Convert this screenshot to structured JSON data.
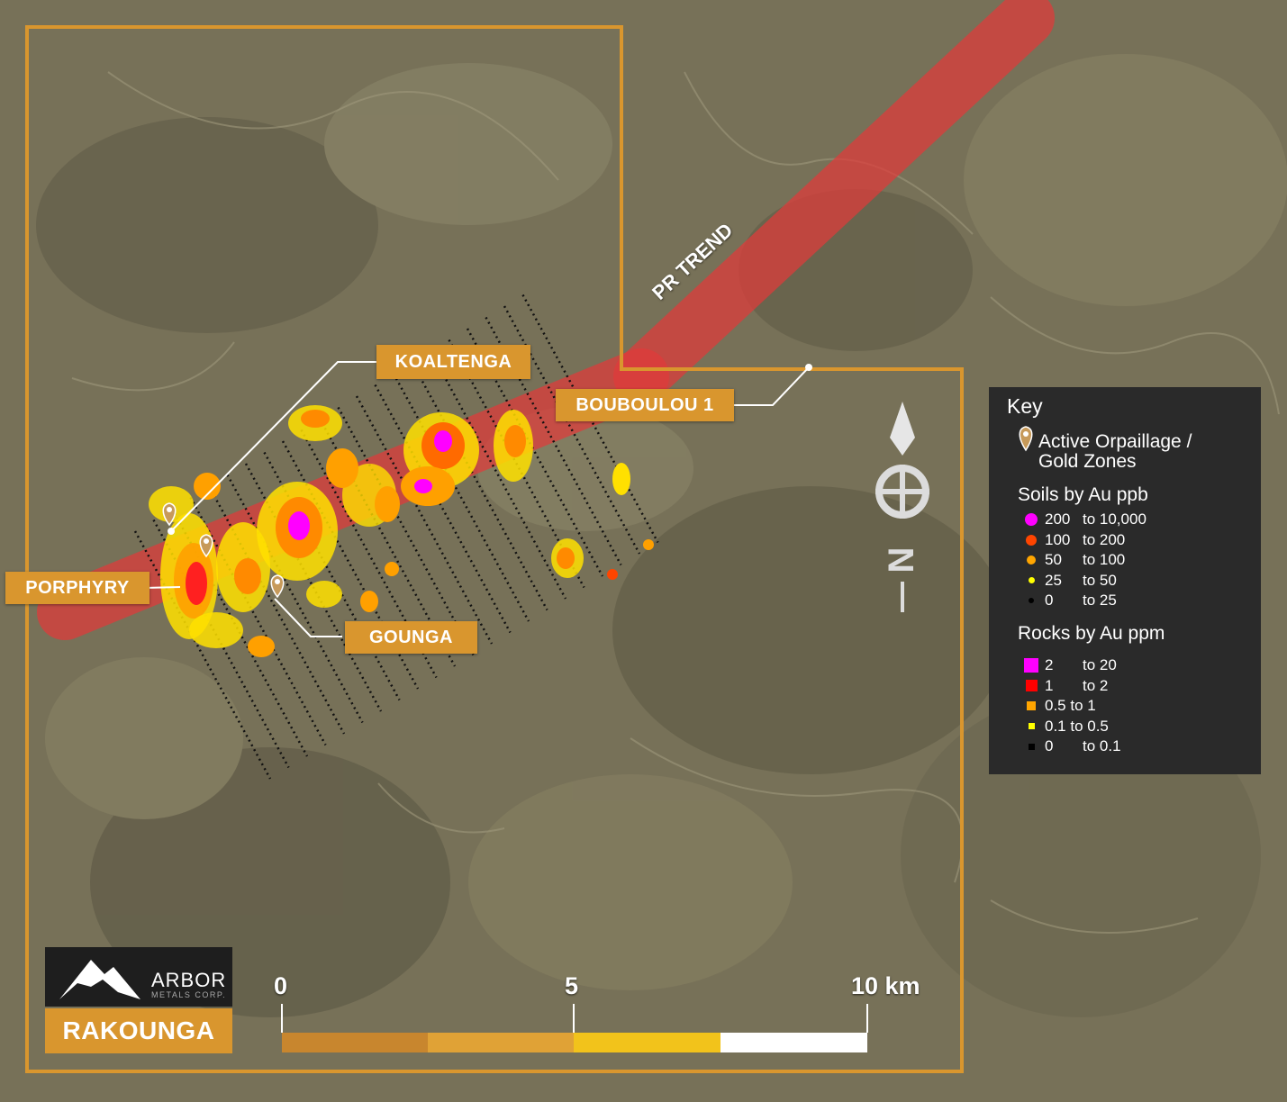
{
  "map": {
    "project_name": "RAKOUNGA",
    "trend_label": "PR TREND",
    "company": {
      "name": "ARBOR",
      "subname": "METALS CORP."
    },
    "callouts": {
      "koaltenga": "KOALTENGA",
      "bouboulou": "BOUBOULOU 1",
      "porphyry": "PORPHYRY",
      "gounga": "GOUNGA"
    },
    "north_label": "N",
    "scale": {
      "ticks": [
        "0",
        "5",
        "10 km"
      ],
      "colors": [
        "#c8862e",
        "#e0a236",
        "#f2c31b",
        "#ffffff"
      ]
    }
  },
  "key": {
    "title": "Key",
    "orpaillage_line1": "Active Orpaillage /",
    "orpaillage_line2": "Gold Zones",
    "soils_title": "Soils by Au ppb",
    "soils": [
      {
        "lo": "200",
        "hi": "to 10,000",
        "color": "#ff00ff"
      },
      {
        "lo": "100",
        "hi": "to 200",
        "color": "#ff4500"
      },
      {
        "lo": "50",
        "hi": "to 100",
        "color": "#ffa500"
      },
      {
        "lo": "25",
        "hi": "to 50",
        "color": "#ffff00"
      },
      {
        "lo": "0",
        "hi": "to 25",
        "color": "#000000"
      }
    ],
    "rocks_title": "Rocks by Au ppm",
    "rocks": [
      {
        "lo": "2",
        "hi": "to 20",
        "color": "#ff00ff"
      },
      {
        "lo": "1",
        "hi": "to 2",
        "color": "#ff0000"
      },
      {
        "lo": "0.5 to 1",
        "hi": "",
        "color": "#ffa500"
      },
      {
        "lo": "0.1 to 0.5",
        "hi": "",
        "color": "#ffff00"
      },
      {
        "lo": "0",
        "hi": "to 0.1",
        "color": "#000000"
      }
    ]
  },
  "colors": {
    "outline": "#d9962e",
    "trend": "#e03a3a",
    "key_bg": "#2a2a2a"
  }
}
